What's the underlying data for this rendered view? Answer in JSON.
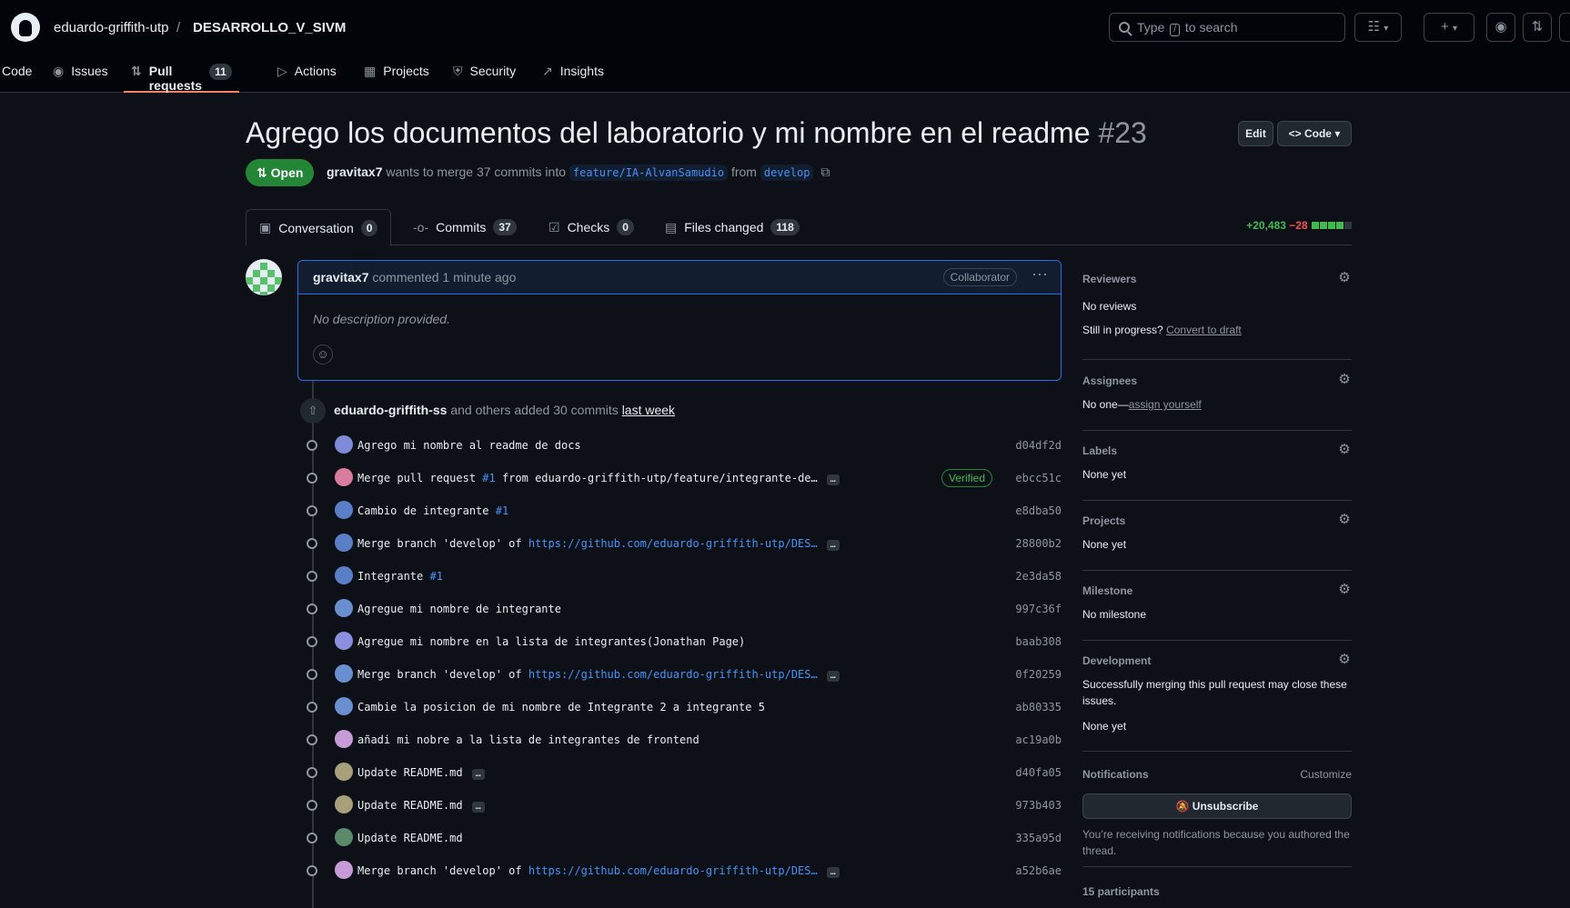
{
  "header": {
    "owner": "eduardo-griffith-utp",
    "separator": "/",
    "repo": "DESARROLLO_V_SIVM",
    "search_pre": "Type",
    "search_key": "/",
    "search_post": "to search"
  },
  "nav": [
    {
      "label": "Code",
      "icon": "code-icon"
    },
    {
      "label": "Issues",
      "icon": "issue-icon"
    },
    {
      "label": "Pull requests",
      "icon": "pr-icon",
      "count": "11"
    },
    {
      "label": "Actions",
      "icon": "play-icon"
    },
    {
      "label": "Projects",
      "icon": "table-icon"
    },
    {
      "label": "Security",
      "icon": "shield-icon"
    },
    {
      "label": "Insights",
      "icon": "graph-icon"
    }
  ],
  "pr": {
    "title": "Agrego los documentos del laboratorio y mi nombre en el readme",
    "number": "#23",
    "edit_label": "Edit",
    "code_label": "Code",
    "state": "Open",
    "author": "gravitax7",
    "merge_text": "wants to merge 37 commits into",
    "base_branch": "feature/IA-AlvanSamudio",
    "from_text": "from",
    "head_branch": "develop"
  },
  "tabs": [
    {
      "label": "Conversation",
      "count": "0"
    },
    {
      "label": "Commits",
      "count": "37"
    },
    {
      "label": "Checks",
      "count": "0"
    },
    {
      "label": "Files changed",
      "count": "118"
    }
  ],
  "diffstat": {
    "additions": "+20,483",
    "deletions": "−28"
  },
  "comment": {
    "author": "gravitax7",
    "action": "commented",
    "time": "1 minute ago",
    "role": "Collaborator",
    "body": "No description provided."
  },
  "push_event": {
    "author": "eduardo-griffith-ss",
    "text": "and others added 30 commits",
    "when": "last week"
  },
  "commits": [
    {
      "msg": "Agrego mi nombre al readme de docs",
      "link": "",
      "suffix": "",
      "more": false,
      "verified": false,
      "sha": "d04df2d",
      "color": "#7d8bd8"
    },
    {
      "msg": "Merge pull request ",
      "link": "#1",
      "suffix": " from eduardo-griffith-utp/feature/integrante-de…",
      "more": true,
      "verified": true,
      "sha": "ebcc51c",
      "color": "#d87d9e"
    },
    {
      "msg": "Cambio de integrante ",
      "link": "#1",
      "suffix": "",
      "more": false,
      "verified": false,
      "sha": "e8dba50",
      "color": "#5b7fc7"
    },
    {
      "msg": "Merge branch 'develop' of ",
      "link": "https://github.com/eduardo-griffith-utp/DES…",
      "suffix": "",
      "more": true,
      "verified": false,
      "sha": "28800b2",
      "color": "#5b7fc7"
    },
    {
      "msg": "Integrante ",
      "link": "#1",
      "suffix": "",
      "more": false,
      "verified": false,
      "sha": "2e3da58",
      "color": "#5b7fc7"
    },
    {
      "msg": "Agregue mi nombre de integrante",
      "link": "",
      "suffix": "",
      "more": false,
      "verified": false,
      "sha": "997c36f",
      "color": "#6a8fd0"
    },
    {
      "msg": "Agregue mi nombre en la lista de integrantes(Jonathan Page)",
      "link": "",
      "suffix": "",
      "more": false,
      "verified": false,
      "sha": "baab308",
      "color": "#8c8fe0"
    },
    {
      "msg": "Merge branch 'develop' of ",
      "link": "https://github.com/eduardo-griffith-utp/DES…",
      "suffix": "",
      "more": true,
      "verified": false,
      "sha": "0f20259",
      "color": "#6a8fd0"
    },
    {
      "msg": "Cambie la posicion de mi nombre de Integrante 2 a integrante 5",
      "link": "",
      "suffix": "",
      "more": false,
      "verified": false,
      "sha": "ab80335",
      "color": "#6a8fd0"
    },
    {
      "msg": "añadi mi nobre a la lista de integrantes de frontend",
      "link": "",
      "suffix": "",
      "more": false,
      "verified": false,
      "sha": "ac19a0b",
      "color": "#c79bd8"
    },
    {
      "msg": "Update README.md",
      "link": "",
      "suffix": "",
      "more": true,
      "verified": false,
      "sha": "d40fa05",
      "color": "#a8a07a"
    },
    {
      "msg": "Update README.md",
      "link": "",
      "suffix": "",
      "more": true,
      "verified": false,
      "sha": "973b403",
      "color": "#a8a07a"
    },
    {
      "msg": "Update README.md",
      "link": "",
      "suffix": "",
      "more": false,
      "verified": false,
      "sha": "335a95d",
      "color": "#5a8a6a"
    },
    {
      "msg": "Merge branch 'develop' of ",
      "link": "https://github.com/eduardo-griffith-utp/DES…",
      "suffix": "",
      "more": true,
      "verified": false,
      "sha": "a52b6ae",
      "color": "#c79bd8"
    }
  ],
  "commit_labels": {
    "verified": "Verified",
    "more": "…"
  },
  "sidebar": {
    "reviewers": {
      "title": "Reviewers",
      "value": "No reviews",
      "progress_q": "Still in progress?",
      "convert": "Convert to draft"
    },
    "assignees": {
      "title": "Assignees",
      "value": "No one—",
      "assign": "assign yourself"
    },
    "labels": {
      "title": "Labels",
      "value": "None yet"
    },
    "projects": {
      "title": "Projects",
      "value": "None yet"
    },
    "milestone": {
      "title": "Milestone",
      "value": "No milestone"
    },
    "development": {
      "title": "Development",
      "line1": "Successfully merging this pull request may close these",
      "line2": "issues.",
      "value": "None yet"
    },
    "notifications": {
      "title": "Notifications",
      "customize": "Customize",
      "unsubscribe": "Unsubscribe",
      "note1": "You’re receiving notifications because you authored the",
      "note2": "thread."
    },
    "participants": "15 participants"
  }
}
